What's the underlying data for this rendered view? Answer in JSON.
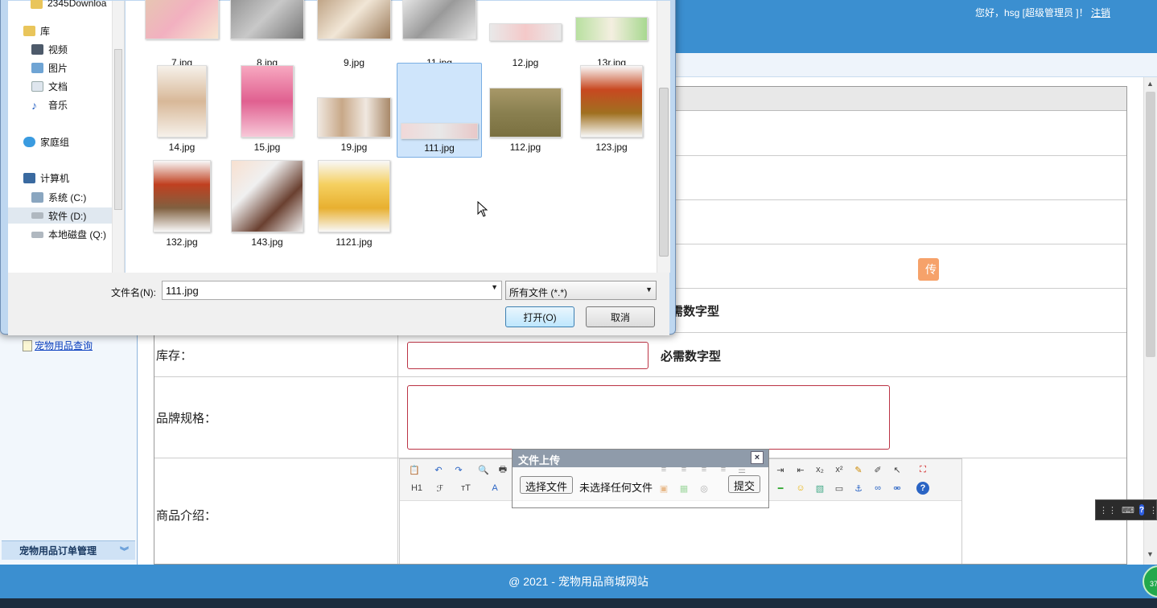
{
  "header": {
    "greeting": "您好，hsg [超级管理员 ]！",
    "logout": "注销"
  },
  "sidebar": {
    "link": "宠物用品查询",
    "category": "宠物用品订单管理"
  },
  "form": {
    "upload_button_partial": "传",
    "price_hint_partial": "需数字型",
    "stock_label": "库存：",
    "stock_hint": "必需数字型",
    "spec_label": "品牌规格：",
    "intro_label": "商品介绍："
  },
  "upload_dialog": {
    "title": "文件上传",
    "choose_button": "选择文件",
    "status": "未选择任何文件",
    "submit": "提交",
    "close": "×"
  },
  "file_dialog": {
    "nav": {
      "folder_top": "2345Downloa",
      "library": "库",
      "videos": "视频",
      "pictures": "图片",
      "documents": "文档",
      "music": "音乐",
      "homegroup": "家庭组",
      "computer": "计算机",
      "drive_c": "系统 (C:)",
      "drive_d": "软件 (D:)",
      "drive_q": "本地磁盘 (Q:)"
    },
    "files": [
      "7.jpg",
      "8.jpg",
      "9.jpg",
      "11.jpg",
      "12.jpg",
      "13r.jpg",
      "14.jpg",
      "15.jpg",
      "19.jpg",
      "111.jpg",
      "112.jpg",
      "123.jpg",
      "132.jpg",
      "143.jpg",
      "1121.jpg"
    ],
    "selected": "111.jpg",
    "filename_label": "文件名(N):",
    "filename_value": "111.jpg",
    "filetype": "所有文件 (*.*)",
    "open": "打开(O)",
    "cancel": "取消"
  },
  "editor": {
    "icons": [
      "paste-icon",
      "undo-icon",
      "redo-icon",
      "preview-icon",
      "print-icon",
      "align-left-icon",
      "align-center-icon",
      "align-right-icon",
      "justify-icon",
      "list-icon",
      "indent-icon",
      "outdent-icon",
      "subscript-icon",
      "superscript-icon",
      "clear-format-icon",
      "select-icon",
      "fullscreen-icon",
      "heading-icon",
      "font-family-icon",
      "font-size-icon",
      "font-color-icon",
      "image-icon",
      "anchor-icon",
      "link-icon",
      "unlink-icon",
      "emoticon-icon",
      "help-icon"
    ],
    "h1": "H1",
    "font_f": "ℱ",
    "font_size": "тT",
    "font_color": "A"
  },
  "footer": {
    "text": "@ 2021 - 宠物用品商城网站"
  },
  "tray": {
    "badge": "37"
  },
  "colors": {
    "header": "#3b8fd0",
    "accent_orange": "#f6a26a",
    "input_border": "#b34"
  }
}
